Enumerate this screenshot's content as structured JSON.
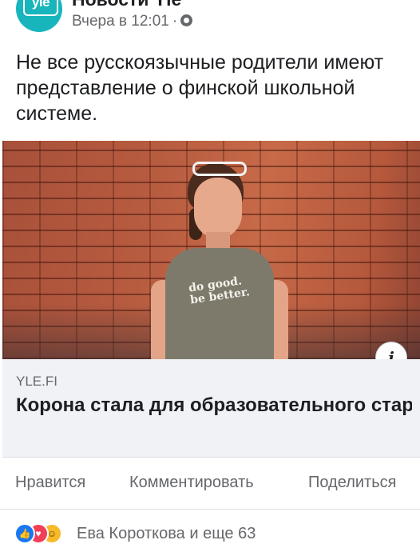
{
  "header": {
    "avatar_text": "yle",
    "page_name": "Новости Yle",
    "timestamp": "Вчера в 12:01",
    "separator": "·",
    "privacy_icon": "globe-icon"
  },
  "post": {
    "text": "Не все русскоязычные родители имеют представление о финской школьной системе."
  },
  "link": {
    "image_shirt_text_line1": "do good.",
    "image_shirt_text_line2": "be better.",
    "info_icon_label": "i",
    "domain": "YLE.FI",
    "title": "Корона стала для образовательного стартапа из Тампере точкой роста: “..."
  },
  "actions": {
    "like_label": "Нравится",
    "comment_label": "Комментировать",
    "share_label": "Поделиться"
  },
  "reactions": {
    "icons": [
      "like-icon",
      "love-icon",
      "haha-icon"
    ],
    "like_glyph": "👍",
    "love_glyph": "♥",
    "haha_glyph": "☺",
    "summary": "Ева Короткова и еще 63"
  },
  "colors": {
    "brand": "#19b5bd",
    "text_primary": "#1c1e21",
    "text_secondary": "#65676b",
    "like_blue": "#1877f2",
    "love_red": "#f33e58",
    "haha_yellow": "#f7b928"
  }
}
